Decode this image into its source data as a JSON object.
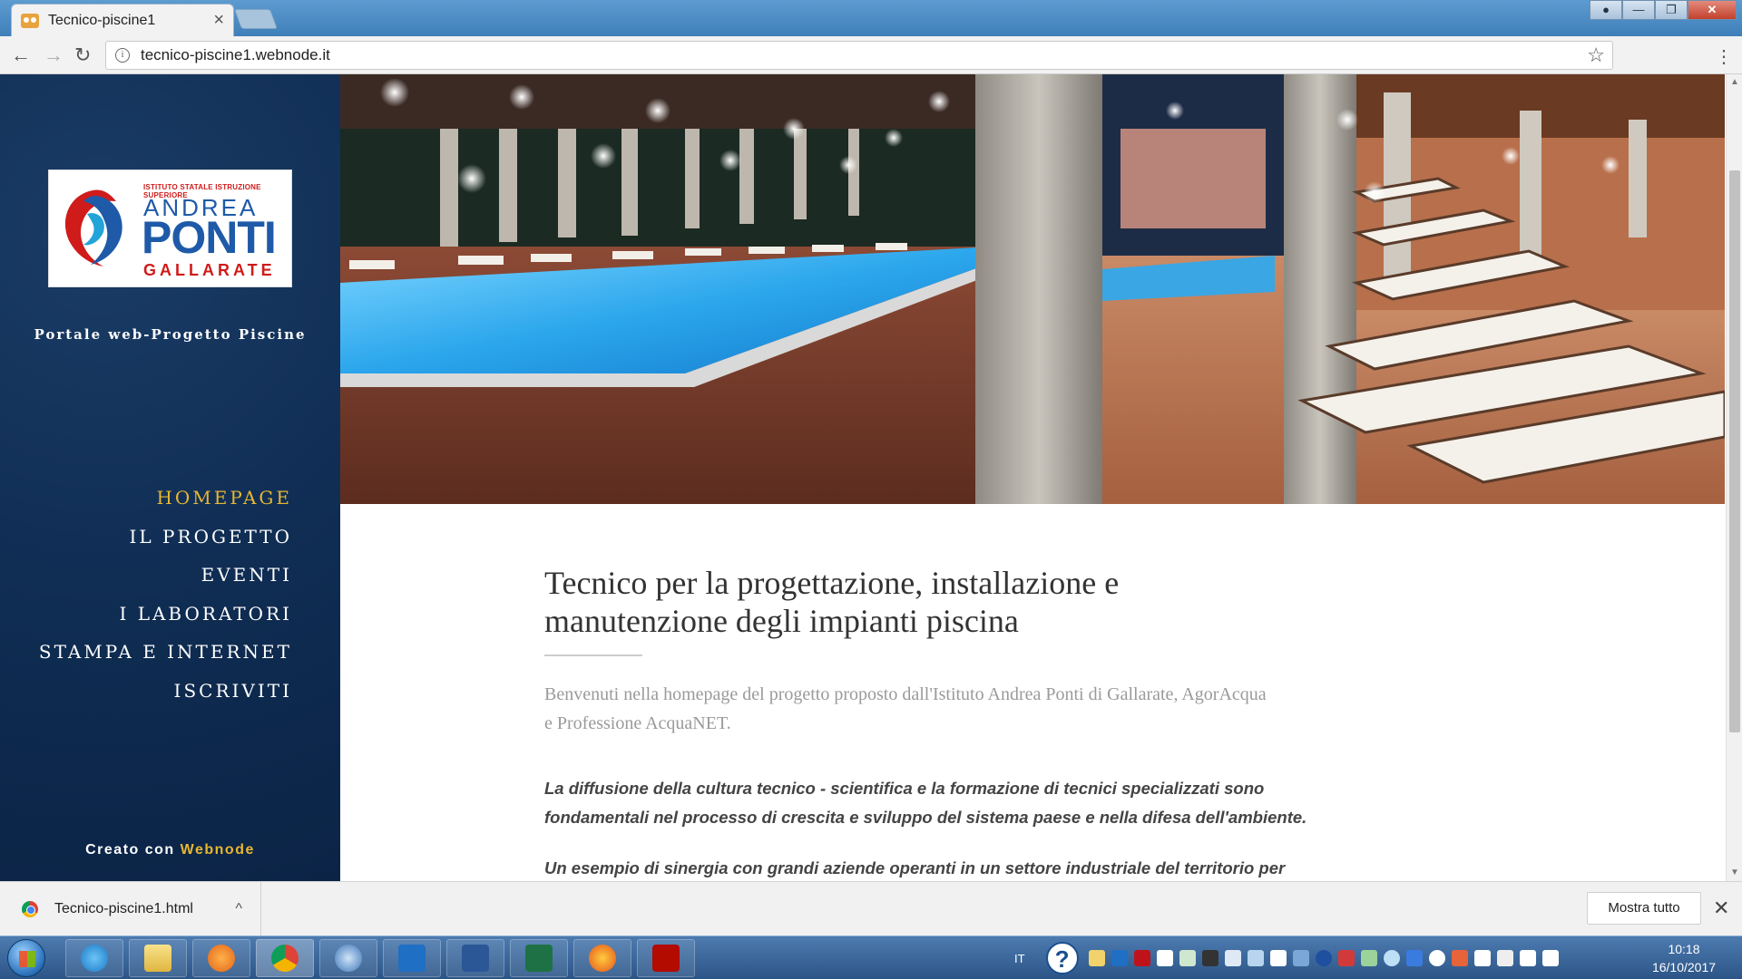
{
  "browser": {
    "tab_title": "Tecnico-piscine1",
    "url": "tecnico-piscine1.webnode.it"
  },
  "sidebar": {
    "logo": {
      "top_line": "ISTITUTO STATALE ISTRUZIONE SUPERIORE",
      "name1": "ANDREA",
      "name2": "PONTI",
      "city": "GALLARATE"
    },
    "tagline": "Portale web-Progetto Piscine",
    "nav": [
      {
        "label": "HOMEPAGE",
        "active": true
      },
      {
        "label": "IL PROGETTO",
        "active": false
      },
      {
        "label": "EVENTI",
        "active": false
      },
      {
        "label": "I LABORATORI",
        "active": false
      },
      {
        "label": "STAMPA E INTERNET",
        "active": false
      },
      {
        "label": "ISCRIVITI",
        "active": false
      }
    ],
    "created_prefix": "Creato con",
    "created_brand": "Webnode"
  },
  "main": {
    "headline_line1": "Tecnico per la progettazione, installazione e",
    "headline_line2": "manutenzione degli impianti piscina",
    "intro_line1": "Benvenuti nella homepage del progetto proposto dall'Istituto Andrea Ponti di Gallarate, AgorAcqua",
    "intro_line2": "e Professione AcquaNET.",
    "para1_line1": "La diffusione della cultura tecnico - scientifica e la formazione di tecnici specializzati sono",
    "para1_line2": "fondamentali nel processo di crescita e sviluppo del sistema paese e nella difesa dell'ambiente.",
    "para2_line1": "Un esempio di sinergia con grandi aziende operanti in un settore industriale del territorio per"
  },
  "download_bar": {
    "file_name": "Tecnico-piscine1.html",
    "show_all": "Mostra tutto"
  },
  "taskbar": {
    "language": "IT",
    "time": "10:18",
    "date": "16/10/2017",
    "apps": [
      "internet-explorer",
      "file-explorer",
      "media-player",
      "chrome",
      "thunderbird",
      "outlook",
      "word",
      "excel",
      "firefox",
      "acrobat"
    ]
  },
  "colors": {
    "sidebar_bg": "#0f2c52",
    "nav_active": "#e8b631",
    "headline": "#333333",
    "intro": "#9a9a9a"
  }
}
